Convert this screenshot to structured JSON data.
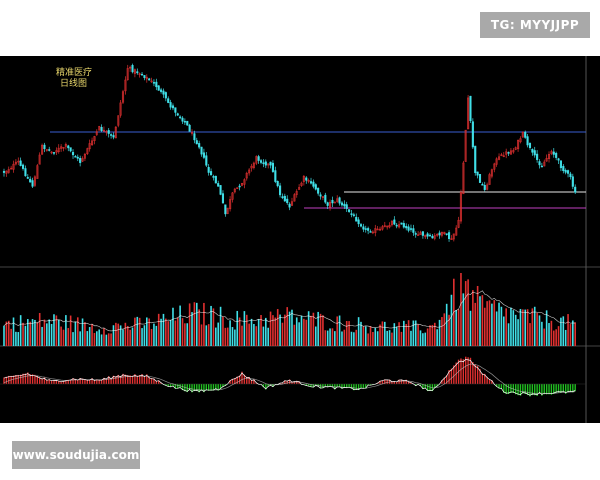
{
  "watermarks": {
    "tg": "TG: MYYJJPP",
    "site": "www.soudujia.com"
  },
  "chart_data": {
    "type": "candlestick",
    "title": "精准医疗",
    "subtitle": "日线图",
    "colors": {
      "background": "#000000",
      "up": "#e03030",
      "down": "#40e0e8",
      "level_blue": "#3a5ecf",
      "level_white": "#e8e8e8",
      "level_magenta": "#c040c0",
      "macd_up": "#e03030",
      "macd_down": "#20c020",
      "dif": "#ffffff",
      "dea": "#c8c8c8",
      "volume_ma": "#ffffff",
      "title_text": "#e8d66b"
    },
    "price_series_key_points": [
      [
        0,
        0.55
      ],
      [
        6,
        0.5
      ],
      [
        12,
        0.62
      ],
      [
        16,
        0.42
      ],
      [
        20,
        0.45
      ],
      [
        26,
        0.42
      ],
      [
        32,
        0.5
      ],
      [
        40,
        0.33
      ],
      [
        46,
        0.38
      ],
      [
        52,
        0.03
      ],
      [
        58,
        0.06
      ],
      [
        64,
        0.12
      ],
      [
        70,
        0.22
      ],
      [
        76,
        0.3
      ],
      [
        82,
        0.42
      ],
      [
        86,
        0.55
      ],
      [
        90,
        0.62
      ],
      [
        93,
        0.76
      ],
      [
        96,
        0.66
      ],
      [
        100,
        0.6
      ],
      [
        106,
        0.48
      ],
      [
        112,
        0.52
      ],
      [
        116,
        0.66
      ],
      [
        120,
        0.72
      ],
      [
        126,
        0.58
      ],
      [
        130,
        0.62
      ],
      [
        136,
        0.71
      ],
      [
        140,
        0.69
      ],
      [
        146,
        0.76
      ],
      [
        152,
        0.84
      ],
      [
        158,
        0.84
      ],
      [
        163,
        0.8
      ],
      [
        168,
        0.82
      ],
      [
        174,
        0.86
      ],
      [
        180,
        0.88
      ],
      [
        184,
        0.85
      ],
      [
        188,
        0.89
      ],
      [
        191,
        0.8
      ],
      [
        193,
        0.5
      ],
      [
        195,
        0.18
      ],
      [
        198,
        0.55
      ],
      [
        202,
        0.64
      ],
      [
        206,
        0.5
      ],
      [
        210,
        0.46
      ],
      [
        214,
        0.44
      ],
      [
        218,
        0.36
      ],
      [
        222,
        0.46
      ],
      [
        226,
        0.52
      ],
      [
        230,
        0.44
      ],
      [
        234,
        0.52
      ],
      [
        238,
        0.58
      ],
      [
        240,
        0.66
      ]
    ],
    "levels": [
      {
        "name": "blue",
        "value_frac": 0.35
      },
      {
        "name": "white",
        "value_frac": 0.65
      },
      {
        "name": "magenta",
        "value_frac": 0.73
      }
    ],
    "volume_series_key_points": [
      [
        0,
        0.3
      ],
      [
        20,
        0.35
      ],
      [
        40,
        0.25
      ],
      [
        60,
        0.3
      ],
      [
        80,
        0.45
      ],
      [
        100,
        0.35
      ],
      [
        120,
        0.4
      ],
      [
        140,
        0.32
      ],
      [
        160,
        0.26
      ],
      [
        180,
        0.25
      ],
      [
        192,
        0.8
      ],
      [
        196,
        0.7
      ],
      [
        200,
        0.55
      ],
      [
        210,
        0.45
      ],
      [
        220,
        0.4
      ],
      [
        230,
        0.35
      ],
      [
        240,
        0.3
      ]
    ],
    "macd_series_key_points": [
      [
        0,
        0.2
      ],
      [
        10,
        0.4
      ],
      [
        20,
        0.1
      ],
      [
        30,
        0.2
      ],
      [
        40,
        0.15
      ],
      [
        50,
        0.35
      ],
      [
        60,
        0.3
      ],
      [
        70,
        -0.1
      ],
      [
        80,
        -0.3
      ],
      [
        90,
        -0.2
      ],
      [
        100,
        0.4
      ],
      [
        110,
        -0.15
      ],
      [
        120,
        0.15
      ],
      [
        130,
        -0.1
      ],
      [
        140,
        -0.15
      ],
      [
        150,
        -0.2
      ],
      [
        160,
        0.15
      ],
      [
        170,
        0.1
      ],
      [
        180,
        -0.3
      ],
      [
        190,
        0.8
      ],
      [
        195,
        1.0
      ],
      [
        200,
        0.5
      ],
      [
        210,
        -0.3
      ],
      [
        220,
        -0.4
      ],
      [
        230,
        -0.35
      ],
      [
        240,
        -0.3
      ]
    ]
  }
}
